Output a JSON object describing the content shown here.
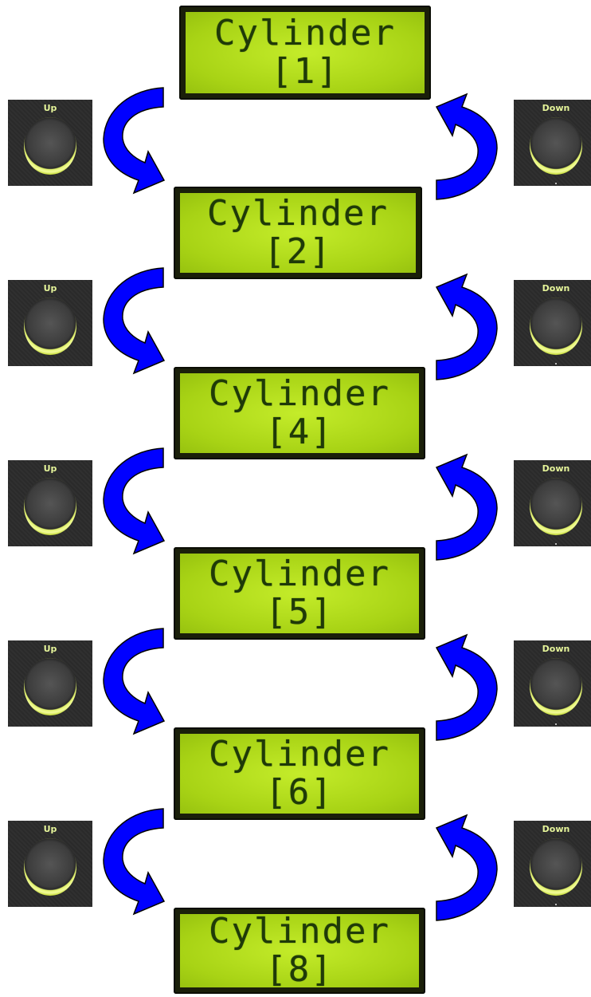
{
  "lcds": [
    {
      "line1": "Cylinder",
      "line2": "[1]"
    },
    {
      "line1": "Cylinder",
      "line2": "[2]"
    },
    {
      "line1": "Cylinder",
      "line2": "[4]"
    },
    {
      "line1": "Cylinder",
      "line2": "[5]"
    },
    {
      "line1": "Cylinder",
      "line2": "[6]"
    },
    {
      "line1": "Cylinder",
      "line2": "[8]"
    }
  ],
  "up_buttons": [
    {
      "label": "Up"
    },
    {
      "label": "Up"
    },
    {
      "label": "Up"
    },
    {
      "label": "Up"
    },
    {
      "label": "Up"
    },
    {
      "label": "Up"
    }
  ],
  "down_buttons": [
    {
      "label": "Down"
    },
    {
      "label": "Down"
    },
    {
      "label": "Down"
    },
    {
      "label": "Down"
    },
    {
      "label": "Down"
    },
    {
      "label": "Down"
    }
  ],
  "colors": {
    "arrow_fill": "#0000ff",
    "arrow_stroke": "#000000",
    "lcd_background": "#b6e11b",
    "lcd_text": "#1f3a08",
    "button_ring": "#e8f57a"
  }
}
